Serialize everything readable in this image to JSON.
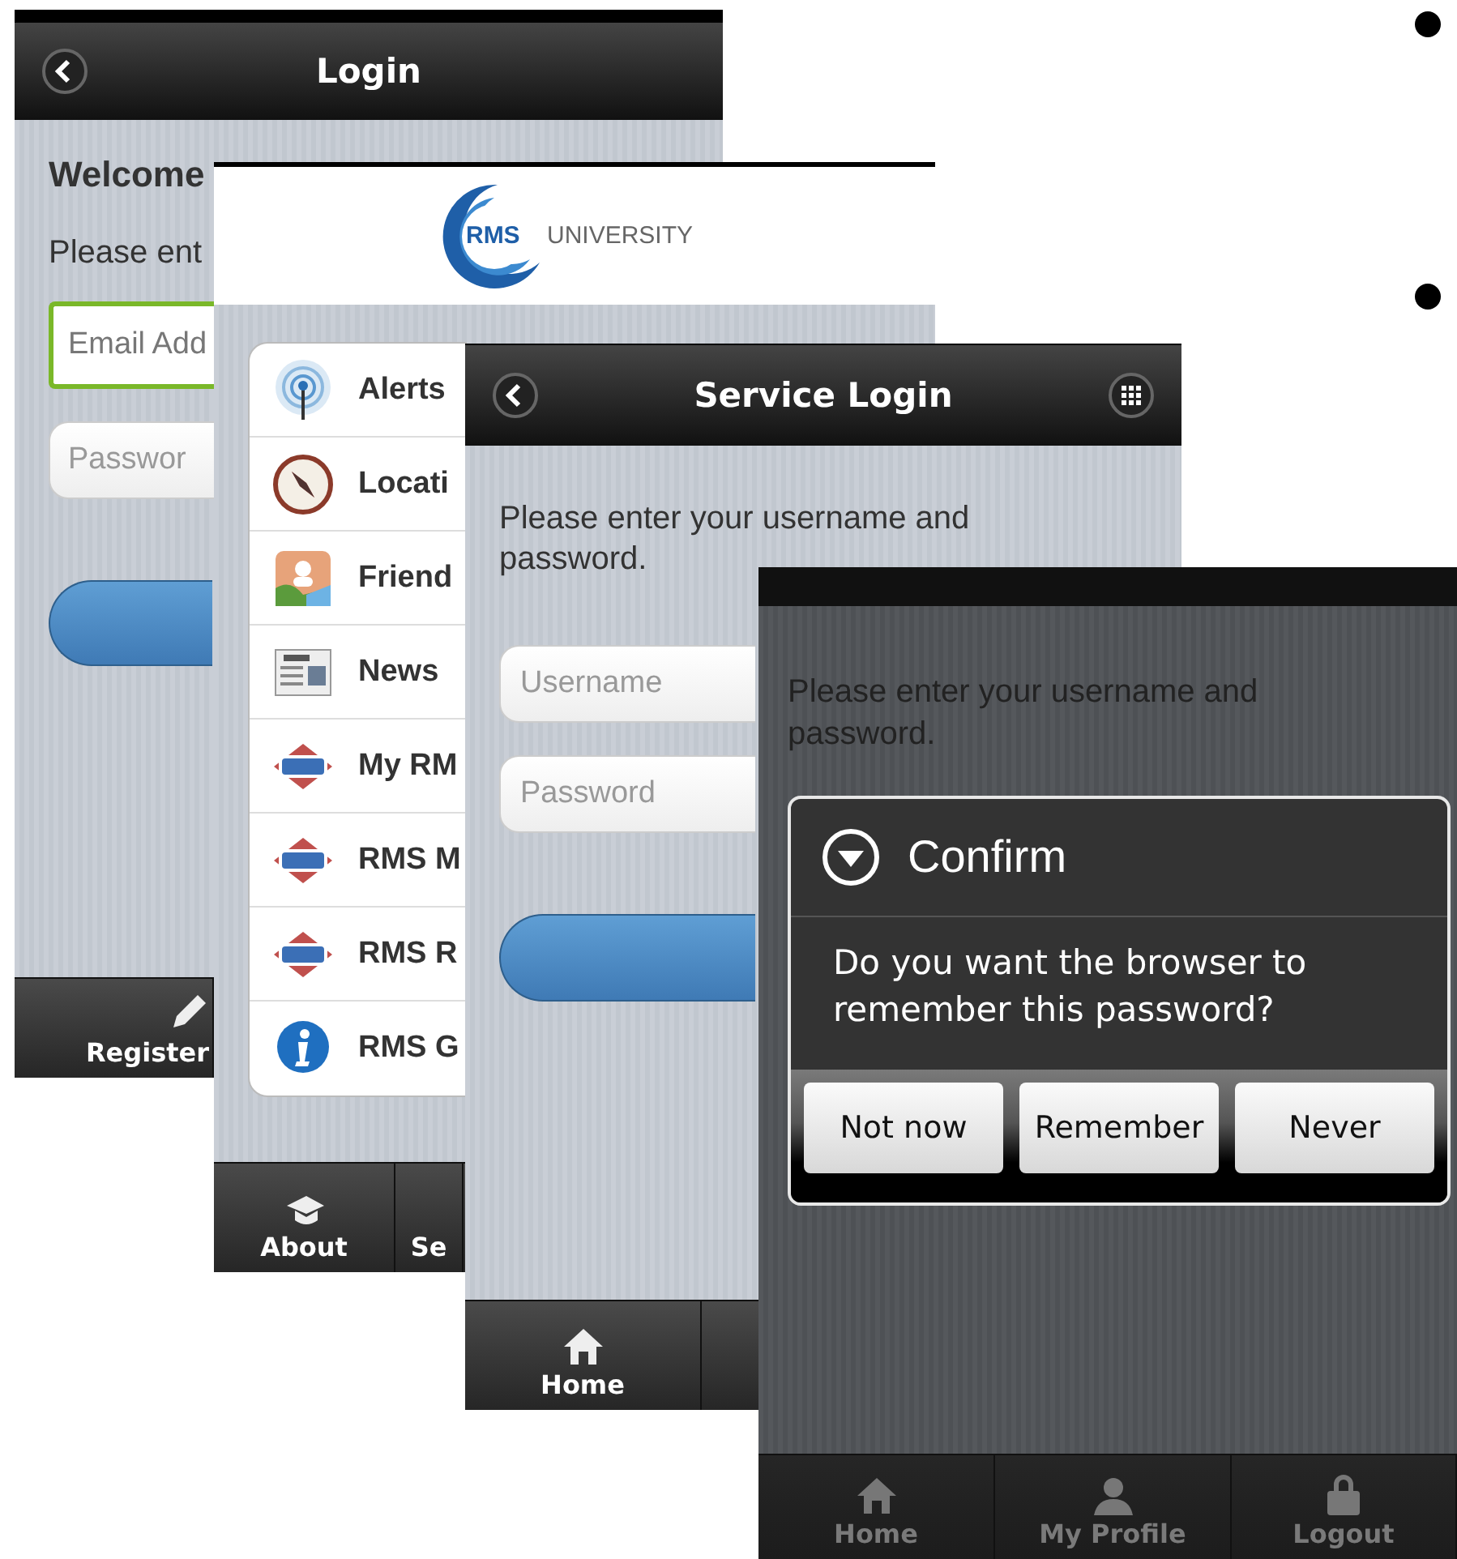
{
  "login_screen": {
    "title": "Login",
    "welcome": "Welcome",
    "prompt": "Please ent",
    "fields": [
      {
        "placeholder": "Email Add",
        "focused": true
      },
      {
        "placeholder": "Passwor",
        "focused": false
      }
    ],
    "tabs": [
      {
        "label": "Register"
      }
    ]
  },
  "menu_screen": {
    "logo": {
      "mark": "RMS",
      "name": "UNIVERSITY"
    },
    "items": [
      {
        "label": "Alerts",
        "kind": "antenna"
      },
      {
        "label": "Locati",
        "kind": "compass"
      },
      {
        "label": "Friend",
        "kind": "contact"
      },
      {
        "label": "News",
        "kind": "news"
      },
      {
        "label": "My RM",
        "kind": "rms"
      },
      {
        "label": "RMS M",
        "kind": "rms"
      },
      {
        "label": "RMS R",
        "kind": "rms"
      },
      {
        "label": "RMS G",
        "kind": "info"
      }
    ],
    "tabs": [
      {
        "label": "About"
      },
      {
        "label": "Se"
      }
    ]
  },
  "service_login_screen": {
    "title": "Service Login",
    "prompt": "Please enter your username and password.",
    "fields": [
      {
        "placeholder": "Username"
      },
      {
        "placeholder": "Password"
      }
    ],
    "tabs": [
      {
        "label": "Home"
      }
    ]
  },
  "confirm_screen": {
    "prompt": "Please enter your username and password.",
    "dialog": {
      "title": "Confirm",
      "message": "Do you want the browser to remember this password?",
      "buttons": [
        "Not now",
        "Remember",
        "Never"
      ]
    },
    "tabs": [
      {
        "label": "Home"
      },
      {
        "label": "My Profile"
      },
      {
        "label": "Logout"
      }
    ]
  }
}
